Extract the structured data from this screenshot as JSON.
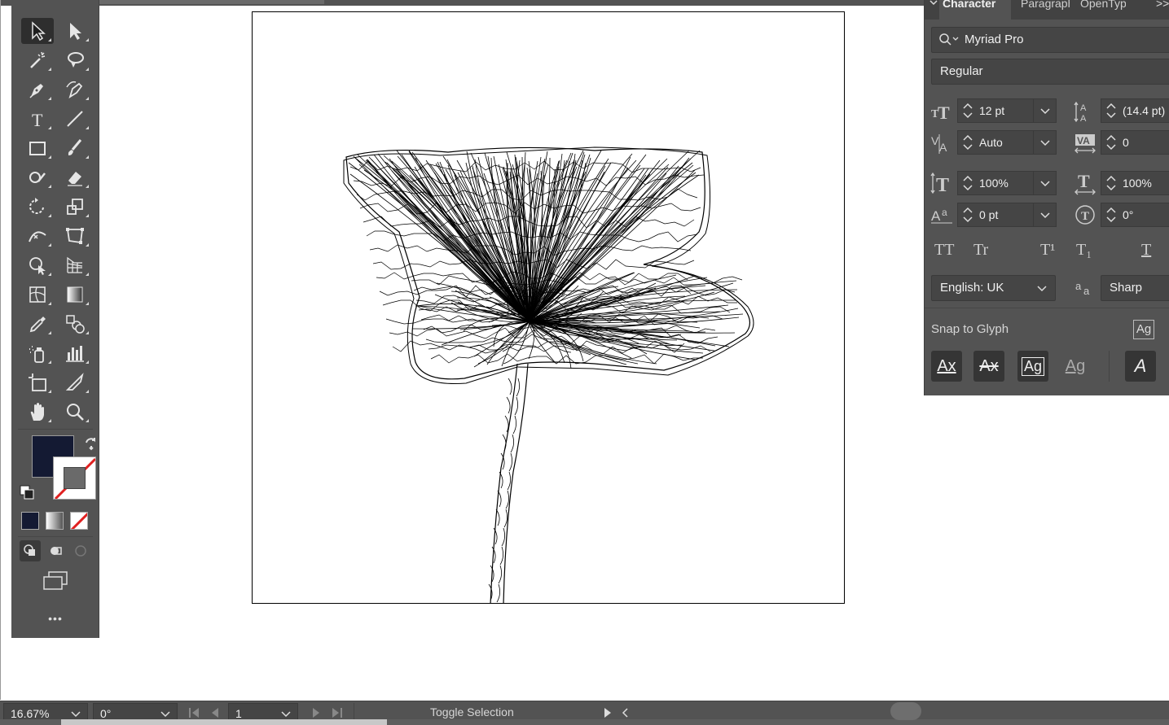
{
  "colors": {
    "fill": "#141a33",
    "ui_dark": "#535353",
    "ui_field": "#454545",
    "none_slash": "#e02020"
  },
  "toolbar": {
    "tools": [
      {
        "name": "selection-tool",
        "icon": "arrow-icon",
        "active": true
      },
      {
        "name": "direct-selection-tool",
        "icon": "white-arrow-icon"
      },
      {
        "name": "magic-wand-tool",
        "icon": "magic-wand-icon"
      },
      {
        "name": "lasso-tool",
        "icon": "lasso-icon"
      },
      {
        "name": "pen-tool",
        "icon": "pen-icon"
      },
      {
        "name": "curvature-tool",
        "icon": "curvature-pen-icon"
      },
      {
        "name": "type-tool",
        "icon": "type-icon"
      },
      {
        "name": "line-segment-tool",
        "icon": "line-icon"
      },
      {
        "name": "rectangle-tool",
        "icon": "rectangle-icon"
      },
      {
        "name": "paintbrush-tool",
        "icon": "brush-icon"
      },
      {
        "name": "shaper-tool",
        "icon": "shaper-icon"
      },
      {
        "name": "eraser-tool",
        "icon": "eraser-icon"
      },
      {
        "name": "rotate-tool",
        "icon": "rotate-icon"
      },
      {
        "name": "scale-tool",
        "icon": "scale-icon"
      },
      {
        "name": "width-tool",
        "icon": "width-icon"
      },
      {
        "name": "free-transform-tool",
        "icon": "free-transform-icon"
      },
      {
        "name": "shape-builder-tool",
        "icon": "shape-builder-icon"
      },
      {
        "name": "perspective-grid-tool",
        "icon": "perspective-grid-icon"
      },
      {
        "name": "mesh-tool",
        "icon": "mesh-icon"
      },
      {
        "name": "gradient-tool",
        "icon": "gradient-icon"
      },
      {
        "name": "eyedropper-tool",
        "icon": "eyedropper-icon"
      },
      {
        "name": "blend-tool",
        "icon": "blend-icon"
      },
      {
        "name": "symbol-sprayer-tool",
        "icon": "symbol-sprayer-icon"
      },
      {
        "name": "column-graph-tool",
        "icon": "column-graph-icon"
      },
      {
        "name": "artboard-tool",
        "icon": "artboard-icon"
      },
      {
        "name": "slice-tool",
        "icon": "slice-icon"
      },
      {
        "name": "hand-tool",
        "icon": "hand-icon"
      },
      {
        "name": "zoom-tool",
        "icon": "zoom-icon"
      }
    ],
    "more_label": "•••"
  },
  "panel": {
    "tabs": [
      "Character",
      "Paragraph",
      "OpenType"
    ],
    "collapse_icon": ">>",
    "font_family": "Myriad Pro",
    "font_style": "Regular",
    "font_size": "12 pt",
    "leading": "(14.4 pt)",
    "kerning": "Auto",
    "tracking": "0",
    "vertical_scale": "100%",
    "horizontal_scale": "100%",
    "baseline_shift": "0 pt",
    "character_rotation": "0°",
    "caps_buttons": [
      "TT",
      "Tr",
      "T¹",
      "T₁",
      "T"
    ],
    "language": "English: UK",
    "anti_aliasing": "Sharp",
    "snap_to_glyph_label": "Snap to Glyph",
    "glyph_icon_text": "Ag",
    "snap_buttons": [
      "Ax",
      "Ax",
      "Ag",
      "Ag",
      "A"
    ]
  },
  "statusbar": {
    "zoom": "16.67%",
    "rotation": "0°",
    "artboard_number": "1",
    "status_label": "Toggle Selection"
  }
}
